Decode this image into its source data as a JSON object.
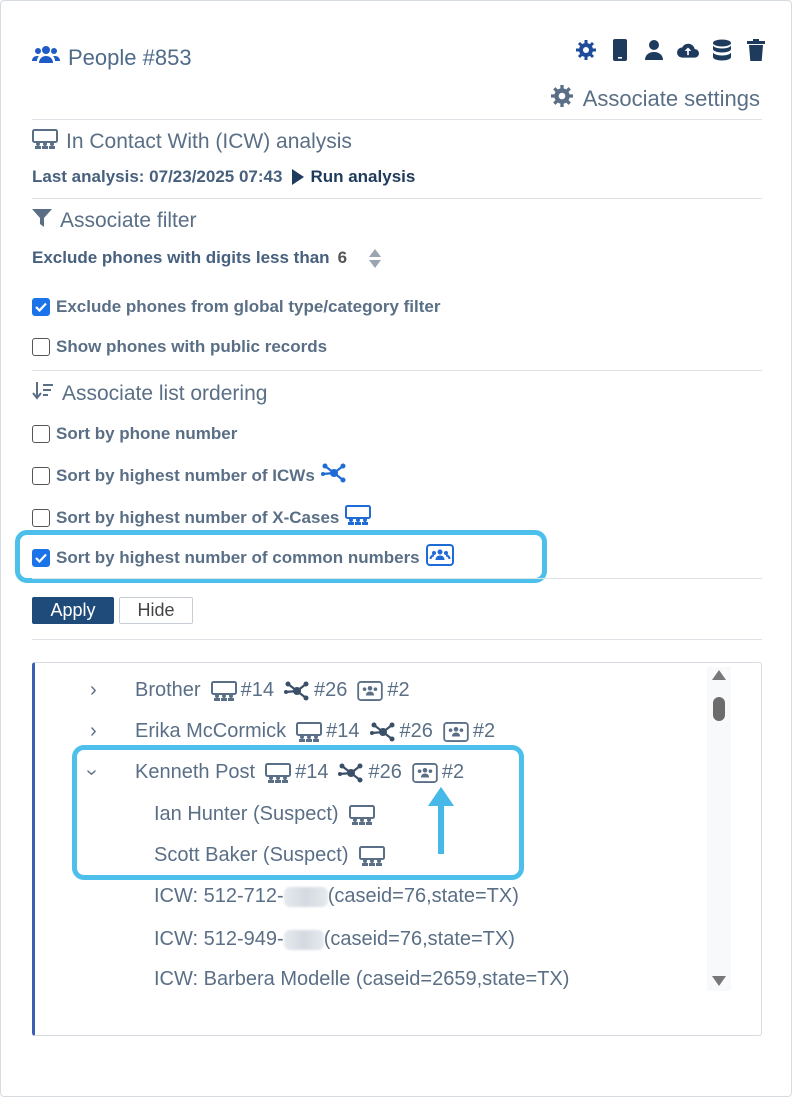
{
  "header": {
    "title": "People #853",
    "toolbar_icons": [
      "settings-gear-icon",
      "mobile-phone-icon",
      "person-icon",
      "cloud-upload-icon",
      "database-icon",
      "trash-icon"
    ]
  },
  "associate_settings_label": "Associate settings",
  "icw": {
    "heading": "In Contact With (ICW) analysis",
    "last_analysis_label": "Last analysis: 07/23/2025 07:43",
    "run_label": "Run analysis"
  },
  "filter": {
    "heading": "Associate filter",
    "min_digits_label": "Exclude phones with digits less than",
    "min_digits_value": "6",
    "exclude_global": {
      "label": "Exclude phones from global type/category filter",
      "checked": true
    },
    "show_public": {
      "label": "Show phones with public records",
      "checked": false
    }
  },
  "ordering": {
    "heading": "Associate list ordering",
    "options": [
      {
        "label": "Sort by phone number",
        "checked": false
      },
      {
        "label": "Sort by highest number of ICWs",
        "checked": false
      },
      {
        "label": "Sort by highest number of X-Cases",
        "checked": false
      },
      {
        "label": "Sort by highest number of common numbers",
        "checked": true
      }
    ]
  },
  "buttons": {
    "apply": "Apply",
    "hide": "Hide"
  },
  "associates": [
    {
      "name": "Brother",
      "xcases": "#14",
      "icws": "#26",
      "common": "#2",
      "expanded": false
    },
    {
      "name": "Erika McCormick",
      "xcases": "#14",
      "icws": "#26",
      "common": "#2",
      "expanded": false
    },
    {
      "name": "Kenneth Post",
      "xcases": "#14",
      "icws": "#26",
      "common": "#2",
      "expanded": true
    }
  ],
  "children": [
    {
      "name": "Ian Hunter (Suspect)"
    },
    {
      "name": "Scott Baker (Suspect)"
    }
  ],
  "icw_rows": [
    {
      "prefix": "ICW: 512-712-",
      "suffix": "(caseid=76,state=TX)"
    },
    {
      "prefix": "ICW: 512-949-",
      "suffix": " (caseid=76,state=TX)"
    },
    {
      "full": "ICW: Barbera Modelle (caseid=2659,state=TX)"
    }
  ],
  "colors": {
    "accent": "#1a73e8",
    "highlight": "#4cc0ea",
    "apply_bg": "#1e4b7a",
    "icon_blue": "#1e5bc6",
    "list_border": "#3b5fb7"
  }
}
